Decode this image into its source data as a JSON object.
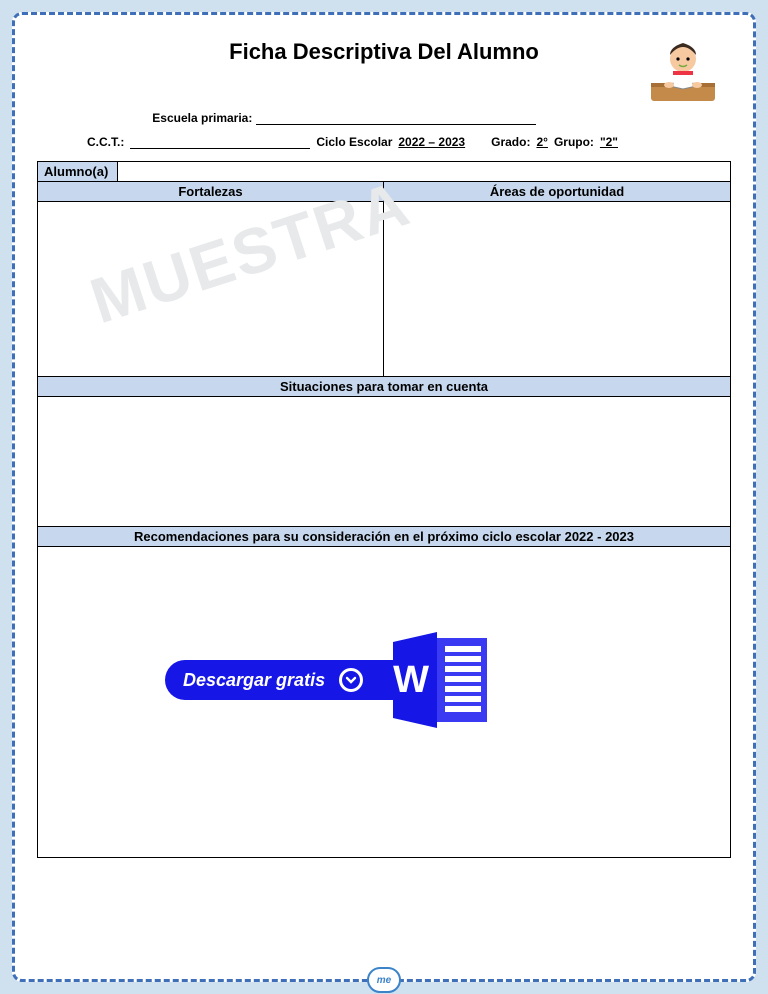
{
  "title": "Ficha Descriptiva Del Alumno",
  "watermark": "MUESTRA",
  "meta": {
    "escuela_label": "Escuela primaria:",
    "cct_label": "C.C.T.:",
    "ciclo_label": "Ciclo Escolar",
    "ciclo_value": "2022 – 2023",
    "grado_label": "Grado:",
    "grado_value": "2°",
    "grupo_label": "Grupo:",
    "grupo_value": "\"2\""
  },
  "headers": {
    "alumno": "Alumno(a)",
    "fortalezas": "Fortalezas",
    "areas": "Áreas de oportunidad",
    "situaciones": "Situaciones para tomar en cuenta",
    "recomendaciones": "Recomendaciones para su consideración en el próximo ciclo escolar 2022 - 2023"
  },
  "download_label": "Descargar gratis",
  "logo_text": "me"
}
